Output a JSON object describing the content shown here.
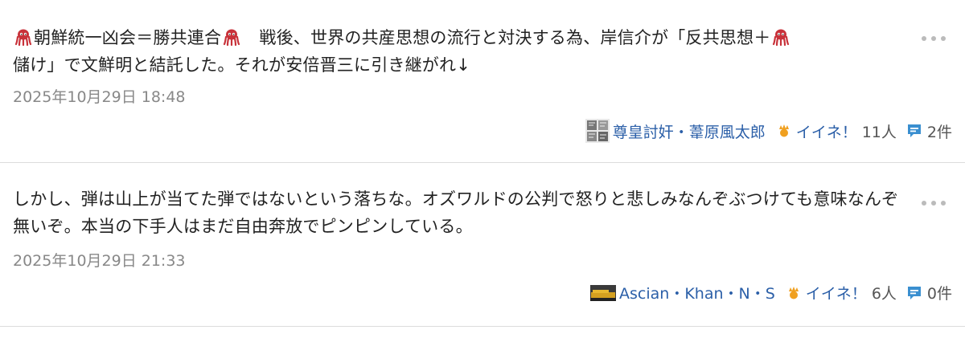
{
  "comments": [
    {
      "text_before": "朝鮮統一凶会＝勝共連合",
      "text_mid": "　戦後、世界の共産思想の流行と対決する為、岸信介が「反共思想＋",
      "text_after": "儲け」で文鮮明と結託した。それが安倍晋三に引き継がれ↓",
      "date": "2025年10月29日 18:48",
      "author": "尊皇討奸・葦原風太郎",
      "like_label": "イイネ！",
      "like_count": "11人",
      "comment_count": "2件"
    },
    {
      "text": "しかし、弾は山上が当てた弾ではないという落ちな。オズワルドの公判で怒りと悲しみなんぞぶつけても意味なんぞ無いぞ。本当の下手人はまだ自由奔放でピンピンしている。",
      "date": "2025年10月29日 21:33",
      "author": "Ascian・Khan・N・S",
      "like_label": "イイネ！",
      "like_count": "6人",
      "comment_count": "0件"
    }
  ],
  "colors": {
    "link": "#2b5fa8",
    "meta": "#888888",
    "like_icon": "#f0a020",
    "comment_icon": "#3a8fd0",
    "octopus": "#c8323a",
    "divider": "#dcdcdc"
  },
  "icons": {
    "more": "more-options-icon",
    "emoji": "octopus-emoji-icon",
    "like": "like-icon",
    "comment": "comment-bubble-icon"
  }
}
